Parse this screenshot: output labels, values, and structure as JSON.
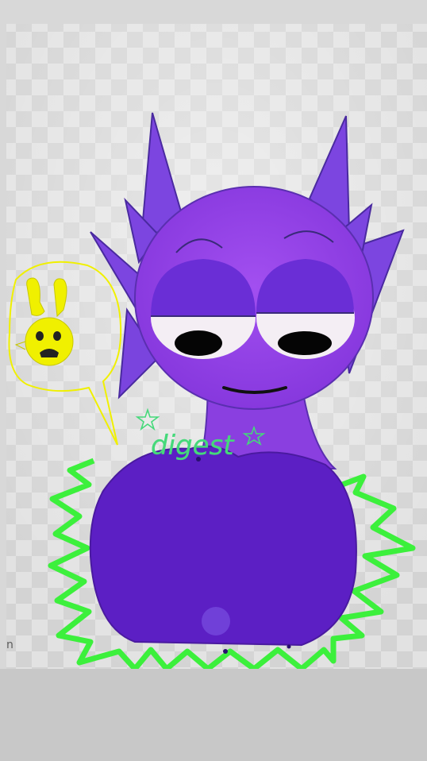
{
  "photo": {
    "handwritten_caption": "digest",
    "stray_letter": "n"
  },
  "colors": {
    "background_frame": "#c6c6c6",
    "character_purple": "#8a3fe0",
    "belly_purple": "#5c1fc4",
    "lid_purple": "#6a2ed6",
    "aura_green": "#3cf03c",
    "sketch_yellow": "#f0f000",
    "caption_green": "#45d97a"
  },
  "icons": [
    "star-doodle-icon",
    "yellow-bunny-doodle-icon"
  ]
}
